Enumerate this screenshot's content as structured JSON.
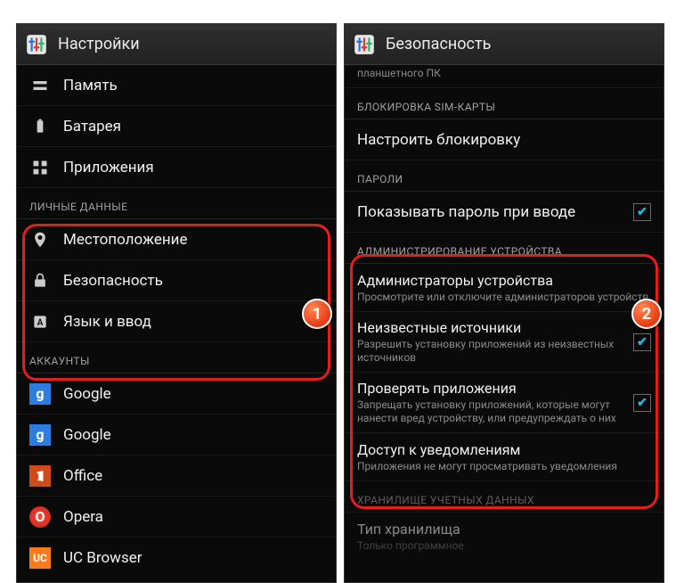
{
  "left": {
    "title": "Настройки",
    "items_top": [
      {
        "label": "Память"
      },
      {
        "label": "Батарея"
      },
      {
        "label": "Приложения"
      }
    ],
    "section_personal": "ЛИЧНЫЕ ДАННЫЕ",
    "items_personal": [
      {
        "label": "Местоположение"
      },
      {
        "label": "Безопасность"
      },
      {
        "label": "Язык и ввод"
      }
    ],
    "section_accounts": "АККАУНТЫ",
    "items_accounts": [
      {
        "label": "Google"
      },
      {
        "label": "Google"
      },
      {
        "label": "Office"
      },
      {
        "label": "Opera"
      },
      {
        "label": "UC Browser"
      }
    ],
    "badge": "1"
  },
  "right": {
    "title": "Безопасность",
    "truncated_top": "планшетного ПК",
    "section_sim": "БЛОКИРОВКА SIM-КАРТЫ",
    "sim_row": "Настроить блокировку",
    "section_passwords": "ПАРОЛИ",
    "pw_row": "Показывать пароль при вводе",
    "section_admin": "АДМИНИСТРИРОВАНИЕ УСТРОЙСТВА",
    "admin_rows": [
      {
        "title": "Администраторы устройства",
        "sub": "Просмотрите или отключите администраторов устройств"
      },
      {
        "title": "Неизвестные источники",
        "sub": "Разрешить установку приложений из неизвестных источников",
        "checked": true
      },
      {
        "title": "Проверять приложения",
        "sub": "Запрещать установку приложений, которые могут нанести вред устройству, или предупреждать о них",
        "checked": true
      },
      {
        "title": "Доступ к уведомлениям",
        "sub": "Приложения не могут просматривать уведомления"
      }
    ],
    "section_store": "ХРАНИЛИЩЕ УЧЕТНЫХ ДАННЫХ",
    "store_row": {
      "title": "Тип хранилища",
      "sub": "Только программное"
    },
    "badge": "2"
  }
}
